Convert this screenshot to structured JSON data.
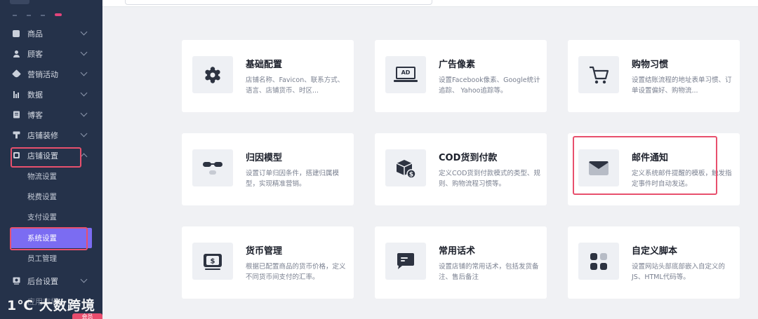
{
  "sidebar": {
    "items": [
      {
        "label": "商品",
        "icon": "box-icon",
        "expanded": false
      },
      {
        "label": "顾客",
        "icon": "person-icon",
        "expanded": false
      },
      {
        "label": "营销活动",
        "icon": "tag-icon",
        "expanded": false
      },
      {
        "label": "数据",
        "icon": "bar-chart-icon",
        "expanded": false
      },
      {
        "label": "博客",
        "icon": "blog-icon",
        "expanded": false
      },
      {
        "label": "店铺装修",
        "icon": "brush-icon",
        "expanded": false
      },
      {
        "label": "店铺设置",
        "icon": "store-settings-icon",
        "expanded": true
      },
      {
        "label": "后台设置",
        "icon": "admin-settings-icon",
        "expanded": false
      }
    ],
    "sub_items": [
      "物流设置",
      "税费设置",
      "支付设置",
      "系统设置",
      "员工管理"
    ],
    "active_sub_item": "系统设置",
    "bottom_partial_label": "应用市场",
    "watermark_logo": "1℃ 大数跨境",
    "watermark_badge": "会员"
  },
  "cards": [
    {
      "title": "基础配置",
      "desc": "店铺名称、Favicon、联系方式、语言、店铺货币、时区...",
      "icon": "gear-icon"
    },
    {
      "title": "广告像素",
      "desc": "设置Facebook像素、Google统计追踪、 Yahoo追踪等。",
      "icon": "ad-icon",
      "icon_text": "AD"
    },
    {
      "title": "购物习惯",
      "desc": "设置结账流程的地址表单习惯、订单设置偏好、购物流...",
      "icon": "cart-icon"
    },
    {
      "title": "归因模型",
      "desc": "设置订单归因条件，搭建归属模型，实现精准营销。",
      "icon": "glasses-icon"
    },
    {
      "title": "COD货到付款",
      "desc": "定义COD货到付款模式的类型、规则、购物流程习惯等。",
      "icon": "cod-package-icon"
    },
    {
      "title": "邮件通知",
      "desc": "定义系统邮件提醒的模板，触发指定事件时自动发送。",
      "icon": "mail-icon"
    },
    {
      "title": "货币管理",
      "desc": "根据已配置商品的货币价格，定义不同货币间支付的汇率。",
      "icon": "currency-icon"
    },
    {
      "title": "常用话术",
      "desc": "设置店铺的常用话术，包括发货备注、售后备注",
      "icon": "chat-icon"
    },
    {
      "title": "自定义脚本",
      "desc": "设置网站头部底部嵌入自定义的JS、HTML代码等。",
      "icon": "script-icon"
    }
  ],
  "colors": {
    "sidebar_bg": "#25324a",
    "active_item": "#7b6cf2",
    "highlight_border": "#e8506d",
    "page_bg": "#f0f1f4"
  }
}
